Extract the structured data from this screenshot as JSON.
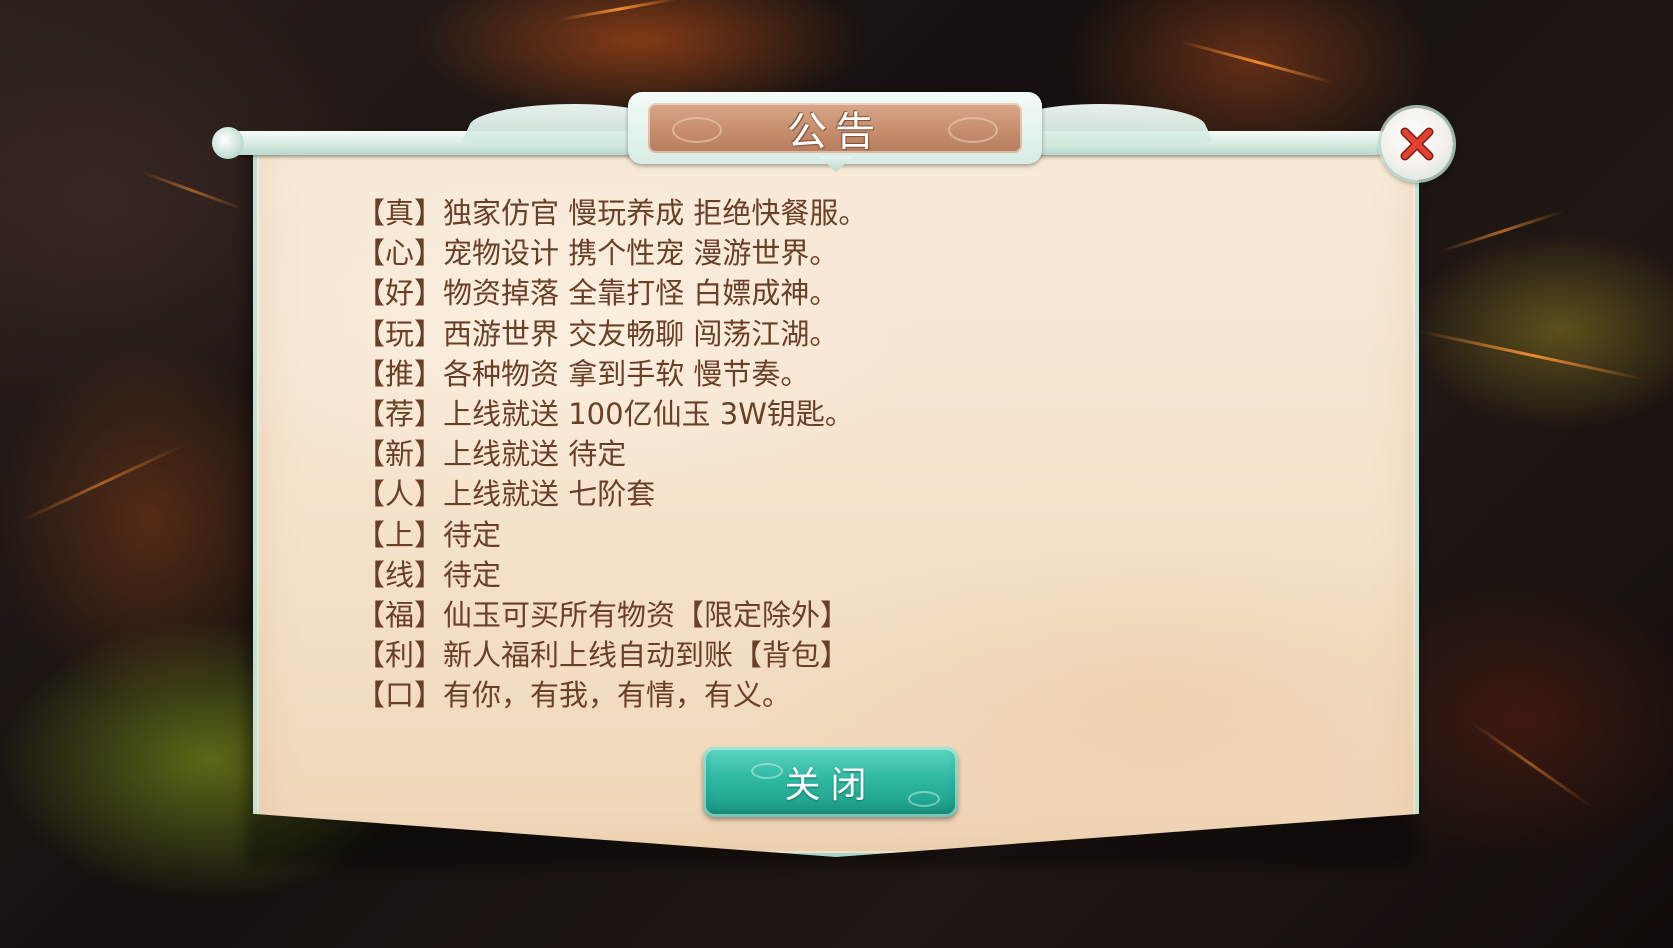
{
  "dialog": {
    "title": "公告",
    "close_button_label": "关闭",
    "close_icon": "close-x-icon",
    "lines": [
      "【真】独家仿官 慢玩养成 拒绝快餐服。",
      "【心】宠物设计 携个性宠 漫游世界。",
      "【好】物资掉落 全靠打怪 白嫖成神。",
      "【玩】西游世界 交友畅聊 闯荡江湖。",
      "【推】各种物资 拿到手软 慢节奏。",
      "【荐】上线就送 100亿仙玉 3W钥匙。",
      "【新】上线就送 待定",
      "【人】上线就送 七阶套",
      "【上】待定",
      "【线】待定",
      "【福】仙玉可买所有物资【限定除外】",
      "【利】新人福利上线自动到账【背包】",
      "【口】有你，有我，有情，有义。"
    ]
  },
  "colors": {
    "parchment": "#f5e2cb",
    "text": "#6a3f2a",
    "button_teal": "#2fb8a2",
    "close_x_red": "#e2412f",
    "plaque": "#c8906f"
  }
}
